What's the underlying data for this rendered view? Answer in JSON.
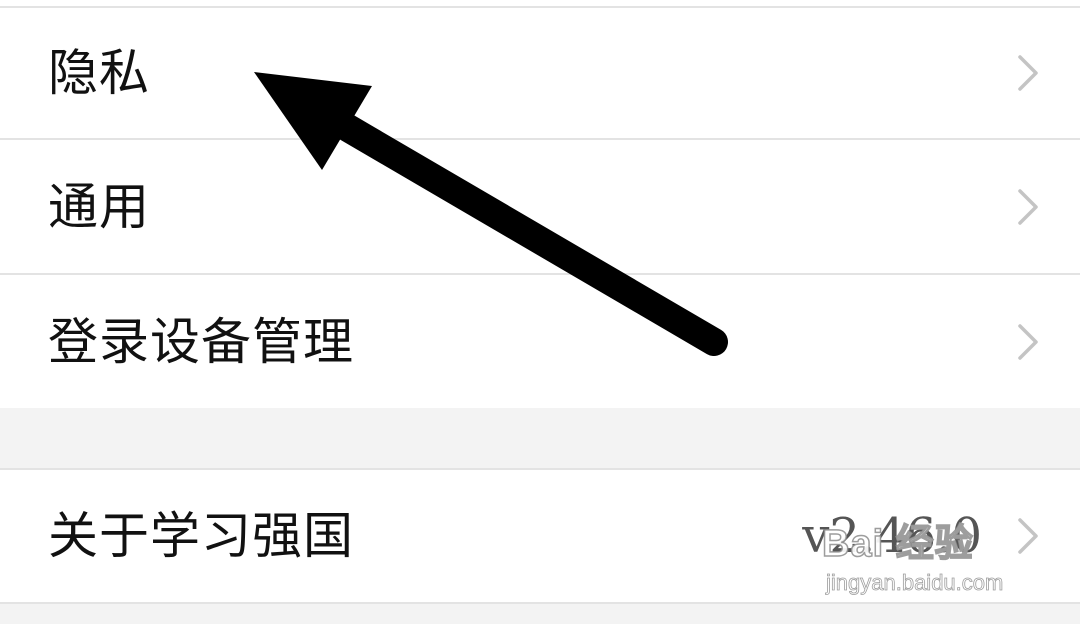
{
  "settings": {
    "items": [
      {
        "label": "隐私"
      },
      {
        "label": "通用"
      },
      {
        "label": "登录设备管理"
      }
    ],
    "about": {
      "label": "关于学习强国",
      "version": "v2.46.0"
    }
  },
  "icons": {
    "chevron": "chevron-right-icon",
    "annotation": "arrow-annotation-icon"
  },
  "colors": {
    "divider": "#e3e3e3",
    "section_gap": "#f3f3f3",
    "text": "#111111",
    "chevron": "#c4c4c4",
    "annotation": "#000000"
  },
  "watermark": {
    "brand": "Bai  经验",
    "url": "jingyan.baidu.com"
  }
}
